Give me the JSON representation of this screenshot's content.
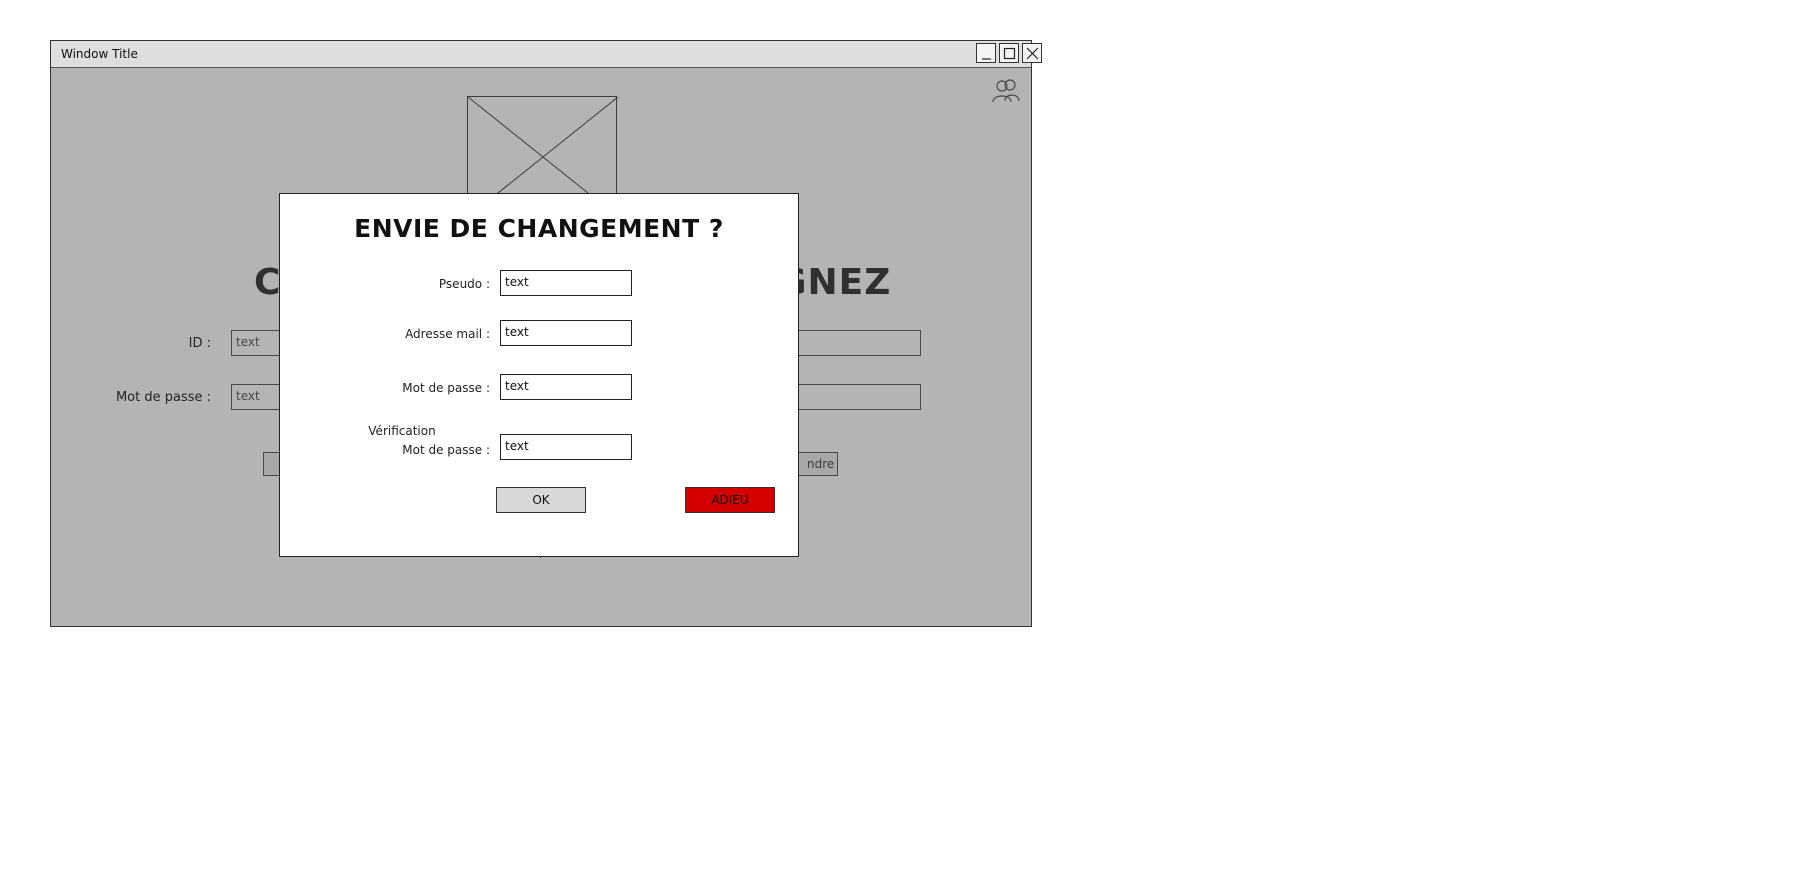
{
  "window": {
    "title": "Window Title",
    "controls": [
      "minimize-icon",
      "maximize-icon",
      "close-icon"
    ]
  },
  "background": {
    "heading_left": "C",
    "heading_right": "GNEZ",
    "id_label": "ID :",
    "id_placeholder": "text",
    "password_label": "Mot de passe :",
    "password_placeholder": "text",
    "button_right_label": "ndre",
    "user_icon": "users-icon"
  },
  "dialog": {
    "title": "ENVIE DE CHANGEMENT ?",
    "fields": [
      {
        "label": "Pseudo :",
        "value": "text"
      },
      {
        "label": "Adresse mail :",
        "value": "text"
      },
      {
        "label": "Mot de passe :",
        "value": "text"
      },
      {
        "label_line1": "Vérification",
        "label_line2": "Mot de passe :",
        "value": "text"
      }
    ],
    "ok_label": "OK",
    "adieu_label": "ADIEU"
  },
  "colors": {
    "overlay": "#b5b5b5",
    "danger_button": "#d40000"
  }
}
